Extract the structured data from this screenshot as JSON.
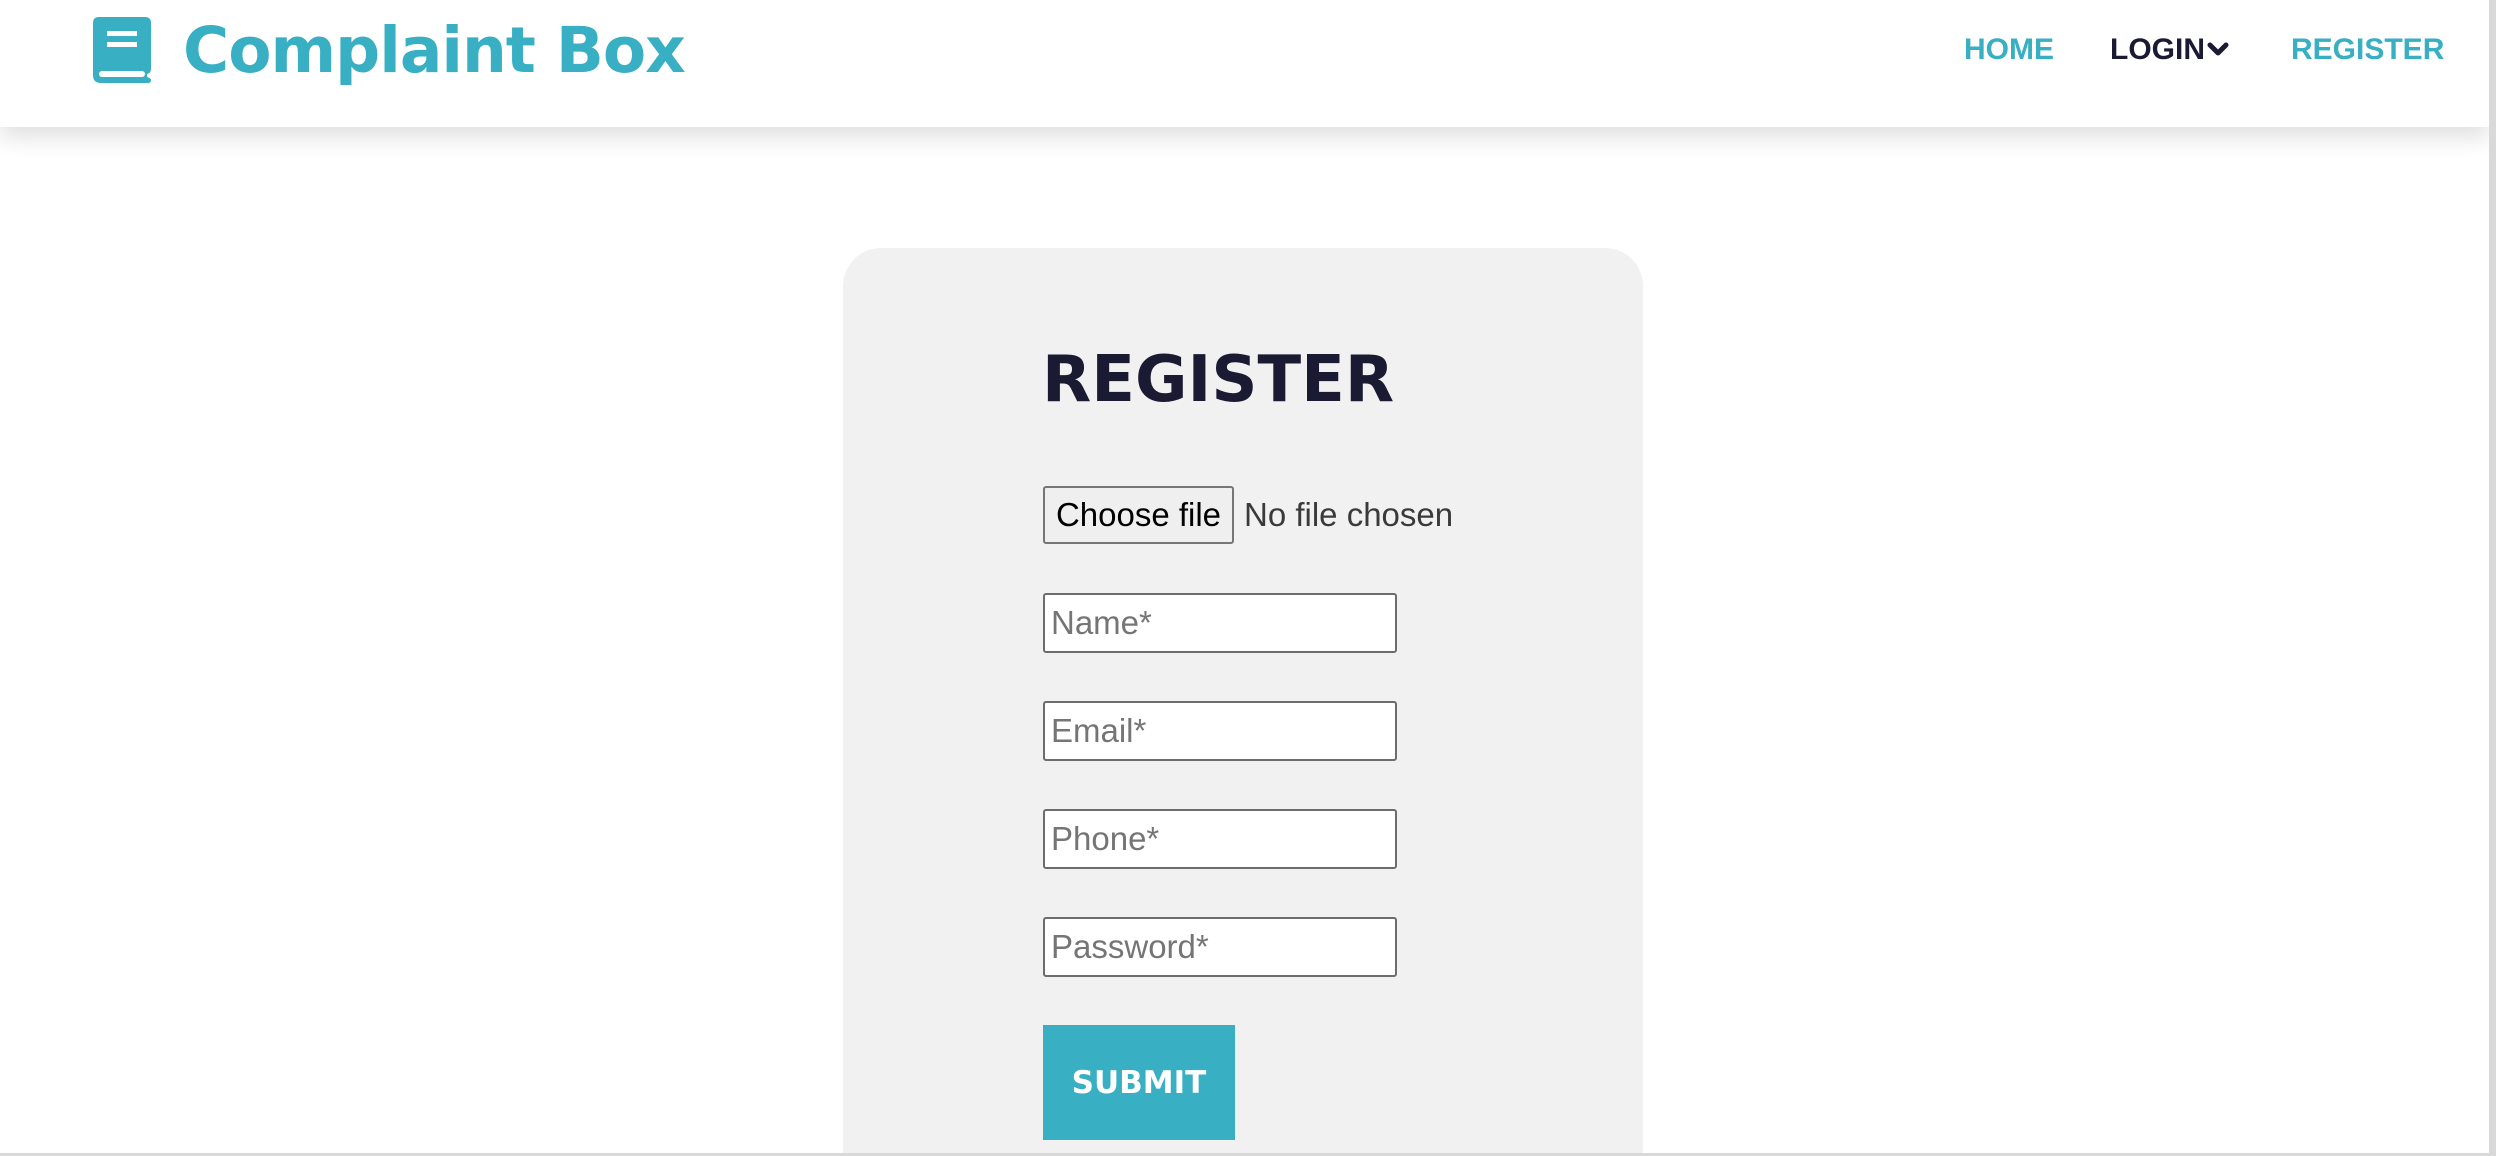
{
  "theme": {
    "accent": "#38afc3",
    "dark_text": "#1b1a33",
    "card_bg": "#f1f1f1"
  },
  "header": {
    "logo_icon": "book-icon",
    "brand": "Complaint Box",
    "nav": {
      "home": "HOME",
      "login": "LOGIN",
      "login_chevron_icon": "chevron-down-icon",
      "register": "REGISTER"
    }
  },
  "form": {
    "title": "REGISTER",
    "file_button_label": "Choose file",
    "file_status": "No file chosen",
    "name_placeholder": "Name*",
    "email_placeholder": "Email*",
    "phone_placeholder": "Phone*",
    "password_placeholder": "Password*",
    "submit_label": "SUBMIT"
  }
}
